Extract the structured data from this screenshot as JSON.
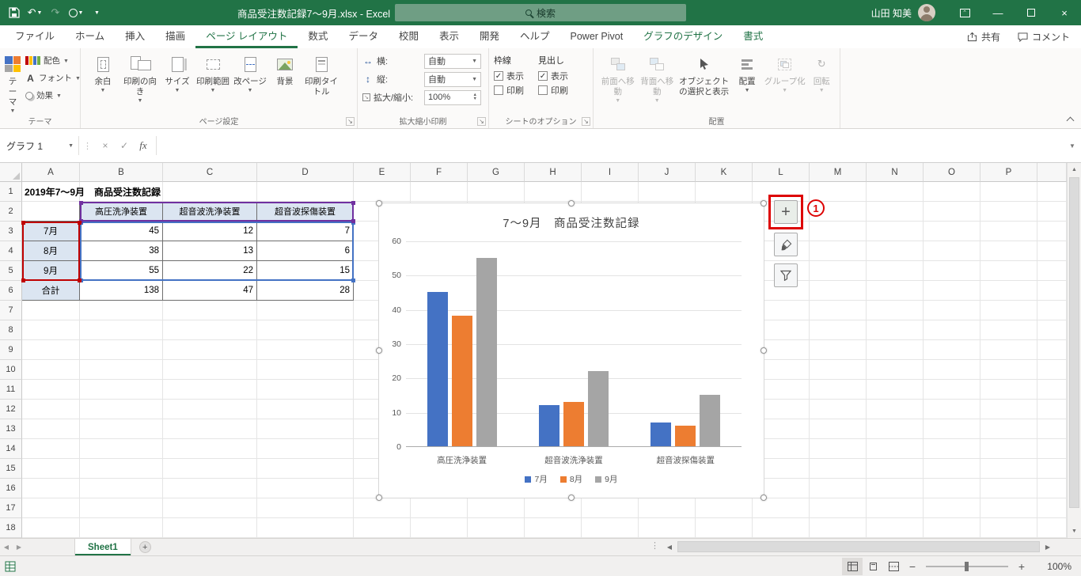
{
  "titlebar": {
    "title": "商品受注数記録7〜9月.xlsx - Excel",
    "search_placeholder": "検索",
    "user_name": "山田 知美"
  },
  "ribbon": {
    "tabs": [
      "ファイル",
      "ホーム",
      "挿入",
      "描画",
      "ページ レイアウト",
      "数式",
      "データ",
      "校閲",
      "表示",
      "開発",
      "ヘルプ",
      "Power Pivot",
      "グラフのデザイン",
      "書式"
    ],
    "active_tab": "ページ レイアウト",
    "contextual_tabs": [
      "グラフのデザイン",
      "書式"
    ],
    "share_label": "共有",
    "comments_label": "コメント",
    "theme_group": {
      "label": "テーマ",
      "main_button": "テーマ",
      "small_buttons": [
        "配色",
        "フォント",
        "効果"
      ]
    },
    "page_setup_group": {
      "label": "ページ設定",
      "buttons": [
        "余白",
        "印刷の向き",
        "サイズ",
        "印刷範囲",
        "改ページ",
        "背景",
        "印刷タイトル"
      ]
    },
    "scale_group": {
      "label": "拡大縮小印刷",
      "fields": [
        {
          "label": "横:",
          "value": "自動"
        },
        {
          "label": "縦:",
          "value": "自動"
        },
        {
          "label": "拡大/縮小:",
          "value": "100%"
        }
      ]
    },
    "sheet_options_group": {
      "label": "シートのオプション",
      "columns": [
        {
          "title": "枠線",
          "options": [
            {
              "label": "表示",
              "checked": true
            },
            {
              "label": "印刷",
              "checked": false
            }
          ]
        },
        {
          "title": "見出し",
          "options": [
            {
              "label": "表示",
              "checked": true
            },
            {
              "label": "印刷",
              "checked": false
            }
          ]
        }
      ]
    },
    "arrange_group": {
      "label": "配置",
      "buttons": [
        {
          "label": "前面へ移動",
          "enabled": false
        },
        {
          "label": "背面へ移動",
          "enabled": false
        },
        {
          "label": "オブジェクトの選択と表示",
          "enabled": true
        },
        {
          "label": "配置",
          "enabled": true
        },
        {
          "label": "グループ化",
          "enabled": false
        },
        {
          "label": "回転",
          "enabled": false
        }
      ]
    }
  },
  "formula_bar": {
    "name_box": "グラフ 1",
    "fx_label": "fx"
  },
  "sheet": {
    "columns": [
      "A",
      "B",
      "C",
      "D",
      "E",
      "F",
      "G",
      "H",
      "I",
      "J",
      "K",
      "L",
      "M",
      "N",
      "O",
      "P"
    ],
    "visible_rows": 18,
    "title_cell": "2019年7〜9月　商品受注数記録",
    "table": {
      "headers": [
        "高圧洗浄装置",
        "超音波洗浄装置",
        "超音波探傷装置"
      ],
      "rows": [
        {
          "label": "7月",
          "values": [
            "45",
            "12",
            "7"
          ]
        },
        {
          "label": "8月",
          "values": [
            "38",
            "13",
            "6"
          ]
        },
        {
          "label": "9月",
          "values": [
            "55",
            "22",
            "15"
          ]
        },
        {
          "label": "合計",
          "values": [
            "138",
            "47",
            "28"
          ]
        }
      ]
    }
  },
  "chart_data": {
    "type": "bar",
    "title": "7〜9月　商品受注数記録",
    "categories": [
      "高圧洗浄装置",
      "超音波洗浄装置",
      "超音波探傷装置"
    ],
    "series": [
      {
        "name": "7月",
        "color": "#4472C4",
        "values": [
          45,
          12,
          7
        ]
      },
      {
        "name": "8月",
        "color": "#ED7D31",
        "values": [
          38,
          13,
          6
        ]
      },
      {
        "name": "9月",
        "color": "#A5A5A5",
        "values": [
          55,
          22,
          15
        ]
      }
    ],
    "ylim": [
      0,
      60
    ],
    "ytick_interval": 10,
    "grid": true,
    "legend_position": "bottom"
  },
  "chart_buttons": {
    "annotation_number": "1"
  },
  "sheet_tabs": {
    "active": "Sheet1"
  },
  "status_bar": {
    "zoom": "100%"
  },
  "colors": {
    "accent": "#217346",
    "range_values": "#4472C4",
    "range_categories": "#C00000",
    "range_headers": "#7030A0",
    "cell_fill": "#DBE5F1"
  }
}
